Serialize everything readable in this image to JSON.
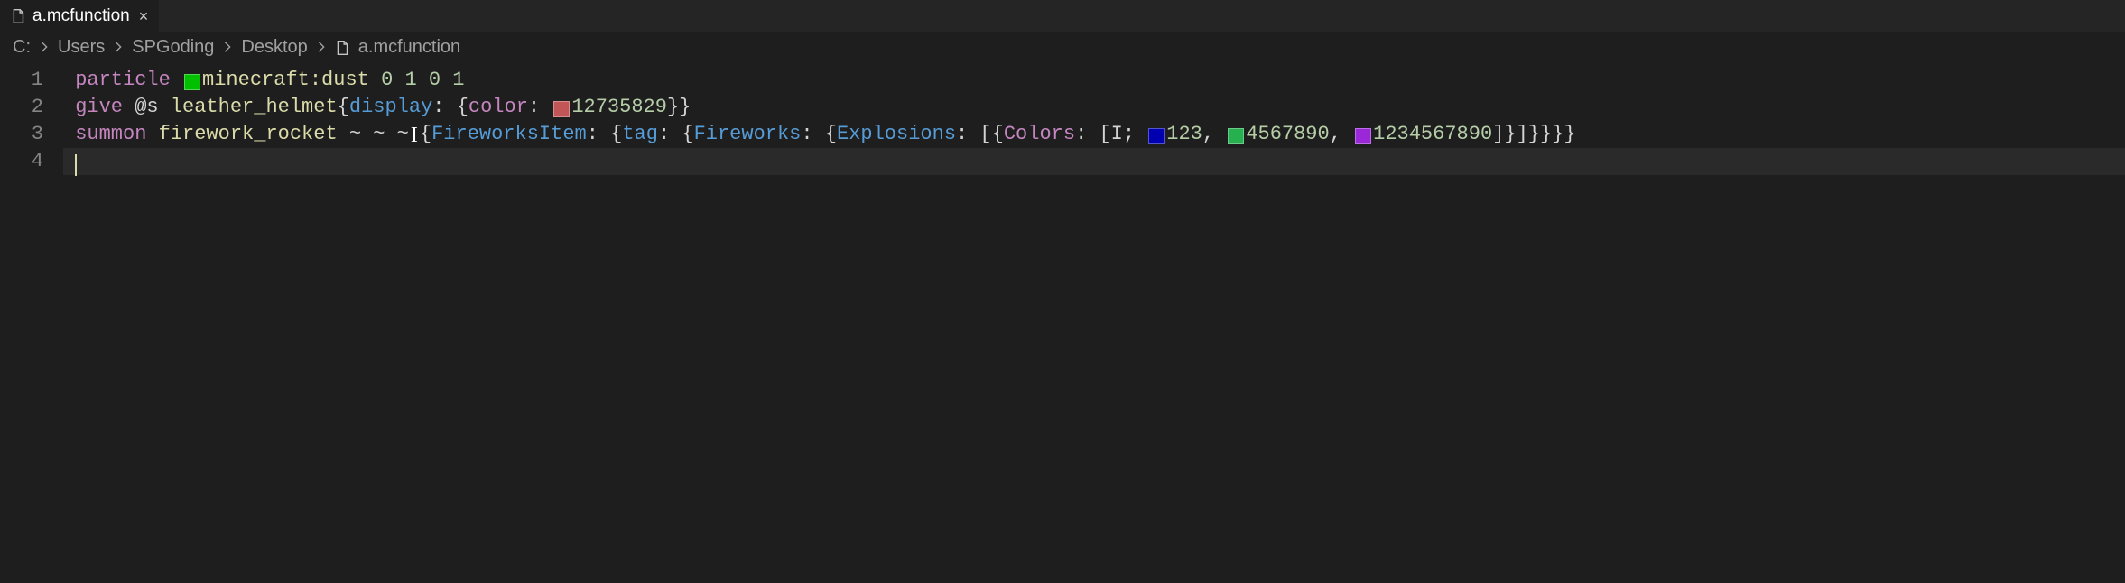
{
  "tab": {
    "filename": "a.mcfunction",
    "close": "×"
  },
  "breadcrumbs": {
    "items": [
      "C:",
      "Users",
      "SPGoding",
      "Desktop"
    ],
    "file": "a.mcfunction"
  },
  "code": {
    "line_numbers": [
      "1",
      "2",
      "3",
      "4"
    ],
    "line1": {
      "cmd": "particle",
      "ident": "minecraft:dust",
      "args": "0 1 0 1",
      "swatch": "#00c000"
    },
    "line2": {
      "cmd": "give",
      "sel": "@s",
      "ident": "leather_helmet",
      "k_display": "display",
      "k_color": "color",
      "val": "12735829",
      "swatch": "#c25555"
    },
    "line3": {
      "cmd": "summon",
      "ident": "firework_rocket",
      "coords": "~ ~ ~",
      "k_fireworksitem": "FireworksItem",
      "k_tag": "tag",
      "k_fireworks": "Fireworks",
      "k_explosions": "Explosions",
      "k_colors": "Colors",
      "arr_prefix": "I;",
      "c1": "123",
      "c2": "4567890",
      "c3": "1234567890",
      "sw1": "#0000b0",
      "sw2": "#26b050",
      "sw3": "#9a28d8"
    }
  }
}
